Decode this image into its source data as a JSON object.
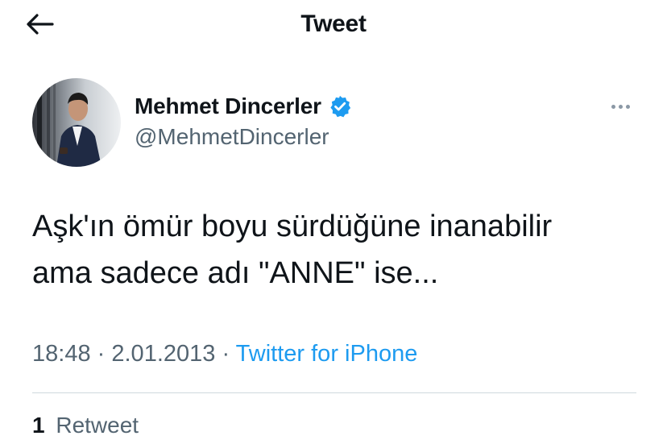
{
  "header": {
    "title": "Tweet",
    "back_icon": "arrow-left-icon"
  },
  "author": {
    "name": "Mehmet Dincerler",
    "handle": "@MehmetDincerler",
    "verified_icon": "verified-badge-icon",
    "verified_color": "#1d9bf0"
  },
  "tweet": {
    "text": "Aşk'ın ömür boyu sürdüğüne inanabilir\nama sadece adı \"ANNE\" ise...",
    "time": "18:48",
    "separator": "·",
    "date": "2.01.2013",
    "source": "Twitter for iPhone"
  },
  "stats": {
    "retweet_count": "1",
    "retweet_label": "Retweet"
  },
  "colors": {
    "accent": "#1d9bf0",
    "text": "#0f1419",
    "secondary": "#536471"
  }
}
